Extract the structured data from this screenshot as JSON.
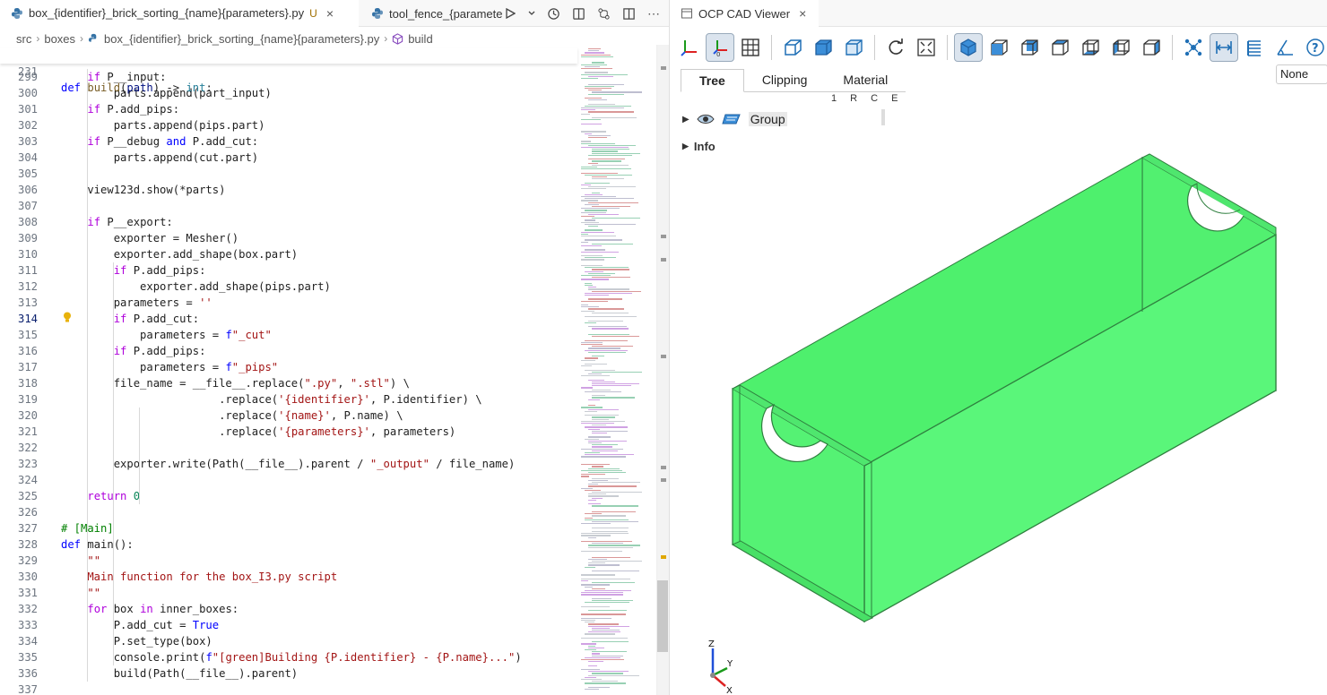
{
  "editor": {
    "tabs": [
      {
        "title": "box_{identifier}_brick_sorting_{name}{parameters}.py",
        "status": "U",
        "close": "×",
        "active": true
      },
      {
        "title": "tool_fence_{paramete",
        "active": false
      }
    ],
    "breadcrumb": [
      "src",
      "boxes",
      "box_{identifier}_brick_sorting_{name}{parameters}.py",
      "build"
    ],
    "sticky": {
      "line": "231",
      "code": "def build(path) -> int:"
    },
    "lines": [
      {
        "n": "299",
        "code": "    if P__input:"
      },
      {
        "n": "300",
        "code": "        parts.append(part_input)"
      },
      {
        "n": "301",
        "code": "    if P.add_pips:"
      },
      {
        "n": "302",
        "code": "        parts.append(pips.part)"
      },
      {
        "n": "303",
        "code": "    if P__debug and P.add_cut:"
      },
      {
        "n": "304",
        "code": "        parts.append(cut.part)"
      },
      {
        "n": "305",
        "code": ""
      },
      {
        "n": "306",
        "code": "    view123d.show(*parts)"
      },
      {
        "n": "307",
        "code": ""
      },
      {
        "n": "308",
        "code": "    if P__export:"
      },
      {
        "n": "309",
        "code": "        exporter = Mesher()"
      },
      {
        "n": "310",
        "code": "        exporter.add_shape(box.part)"
      },
      {
        "n": "311",
        "code": "        if P.add_pips:"
      },
      {
        "n": "312",
        "code": "            exporter.add_shape(pips.part)"
      },
      {
        "n": "313",
        "code": "        parameters = ''"
      },
      {
        "n": "314",
        "code": "        if P.add_cut:"
      },
      {
        "n": "315",
        "code": "            parameters = f\"_cut\""
      },
      {
        "n": "316",
        "code": "        if P.add_pips:"
      },
      {
        "n": "317",
        "code": "            parameters = f\"_pips\""
      },
      {
        "n": "318",
        "code": "        file_name = __file__.replace(\".py\", \".stl\") \\"
      },
      {
        "n": "319",
        "code": "                        .replace('{identifier}', P.identifier) \\"
      },
      {
        "n": "320",
        "code": "                        .replace('{name}', P.name) \\"
      },
      {
        "n": "321",
        "code": "                        .replace('{parameters}', parameters)"
      },
      {
        "n": "322",
        "code": ""
      },
      {
        "n": "323",
        "code": "        exporter.write(Path(__file__).parent / \"_output\" / file_name)"
      },
      {
        "n": "324",
        "code": ""
      },
      {
        "n": "325",
        "code": "    return 0"
      },
      {
        "n": "326",
        "code": ""
      },
      {
        "n": "327",
        "code": "# [Main]"
      },
      {
        "n": "328",
        "code": "def main():"
      },
      {
        "n": "329",
        "code": "    \"\"\""
      },
      {
        "n": "330",
        "code": "    Main function for the box_I3.py script"
      },
      {
        "n": "331",
        "code": "    \"\"\""
      },
      {
        "n": "332",
        "code": "    for box in inner_boxes:"
      },
      {
        "n": "333",
        "code": "        P.add_cut = True"
      },
      {
        "n": "334",
        "code": "        P.set_type(box)"
      },
      {
        "n": "335",
        "code": "        console.print(f\"[green]Building {P.identifier} - {P.name}...\")"
      },
      {
        "n": "336",
        "code": "        build(Path(__file__).parent)"
      },
      {
        "n": "337",
        "code": ""
      }
    ],
    "current_line": "314"
  },
  "viewer": {
    "tab_title": "OCP CAD Viewer",
    "tab_close": "×",
    "panel_tabs": [
      "Tree",
      "Clipping",
      "Material"
    ],
    "active_panel": "Tree",
    "columns": "1 R C E",
    "tree_item": "Group",
    "info_label": "Info",
    "dropdown_value": "None",
    "axes": {
      "z": "Z",
      "y": "Y",
      "x": "X"
    },
    "colors": {
      "model_fill": "#58f878",
      "model_edge": "#3a9a50",
      "accent": "#1f6fb5"
    }
  }
}
